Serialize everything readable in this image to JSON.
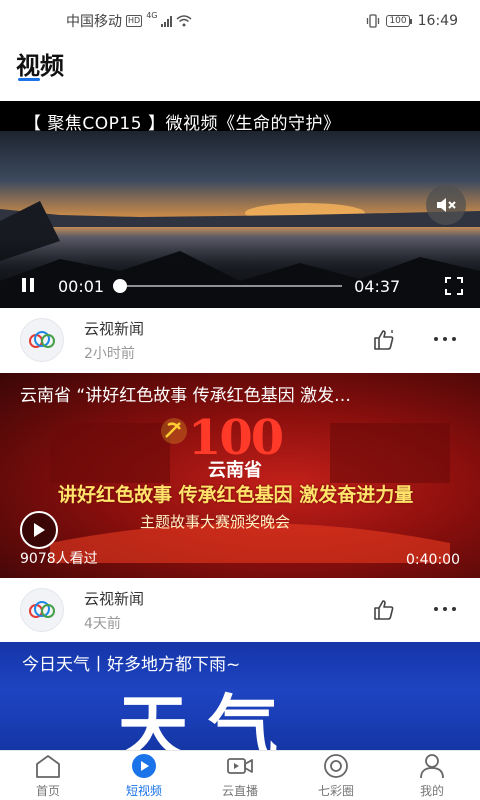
{
  "status_bar": {
    "carrier": "中国移动",
    "hd_badge": "HD",
    "network": "4G",
    "battery": "100",
    "time": "16:49"
  },
  "page": {
    "title": "视频"
  },
  "player": {
    "title": "【 聚焦COP15 】微视频《生命的守护》",
    "current_time": "00:01",
    "total_time": "04:37",
    "progress": 0.0
  },
  "items": [
    {
      "source": "云视新闻",
      "time": "2小时前"
    },
    {
      "source": "云视新闻",
      "time": "4天前"
    }
  ],
  "card2": {
    "title": "云南省 “讲好红色故事 传承红色基因 激发…",
    "badge": "100",
    "sub": "云南省",
    "headline": "讲好红色故事 传承红色基因 激发奋进力量",
    "event": "主题故事大赛颁奖晚会",
    "views": "9078人看过",
    "duration": "0:40:00"
  },
  "card3": {
    "title": "今日天气丨好多地方都下雨~",
    "big_text": "天气"
  },
  "bottom_nav": {
    "active_index": 1,
    "items": [
      {
        "label": "首页",
        "icon": "home-icon"
      },
      {
        "label": "短视频",
        "icon": "play-circle-icon"
      },
      {
        "label": "云直播",
        "icon": "camera-icon"
      },
      {
        "label": "七彩圈",
        "icon": "circle-target-icon"
      },
      {
        "label": "我的",
        "icon": "user-icon"
      }
    ]
  },
  "colors": {
    "accent": "#1a73e8",
    "red_banner": "#c4201a",
    "weather_blue": "#1e44c2"
  }
}
